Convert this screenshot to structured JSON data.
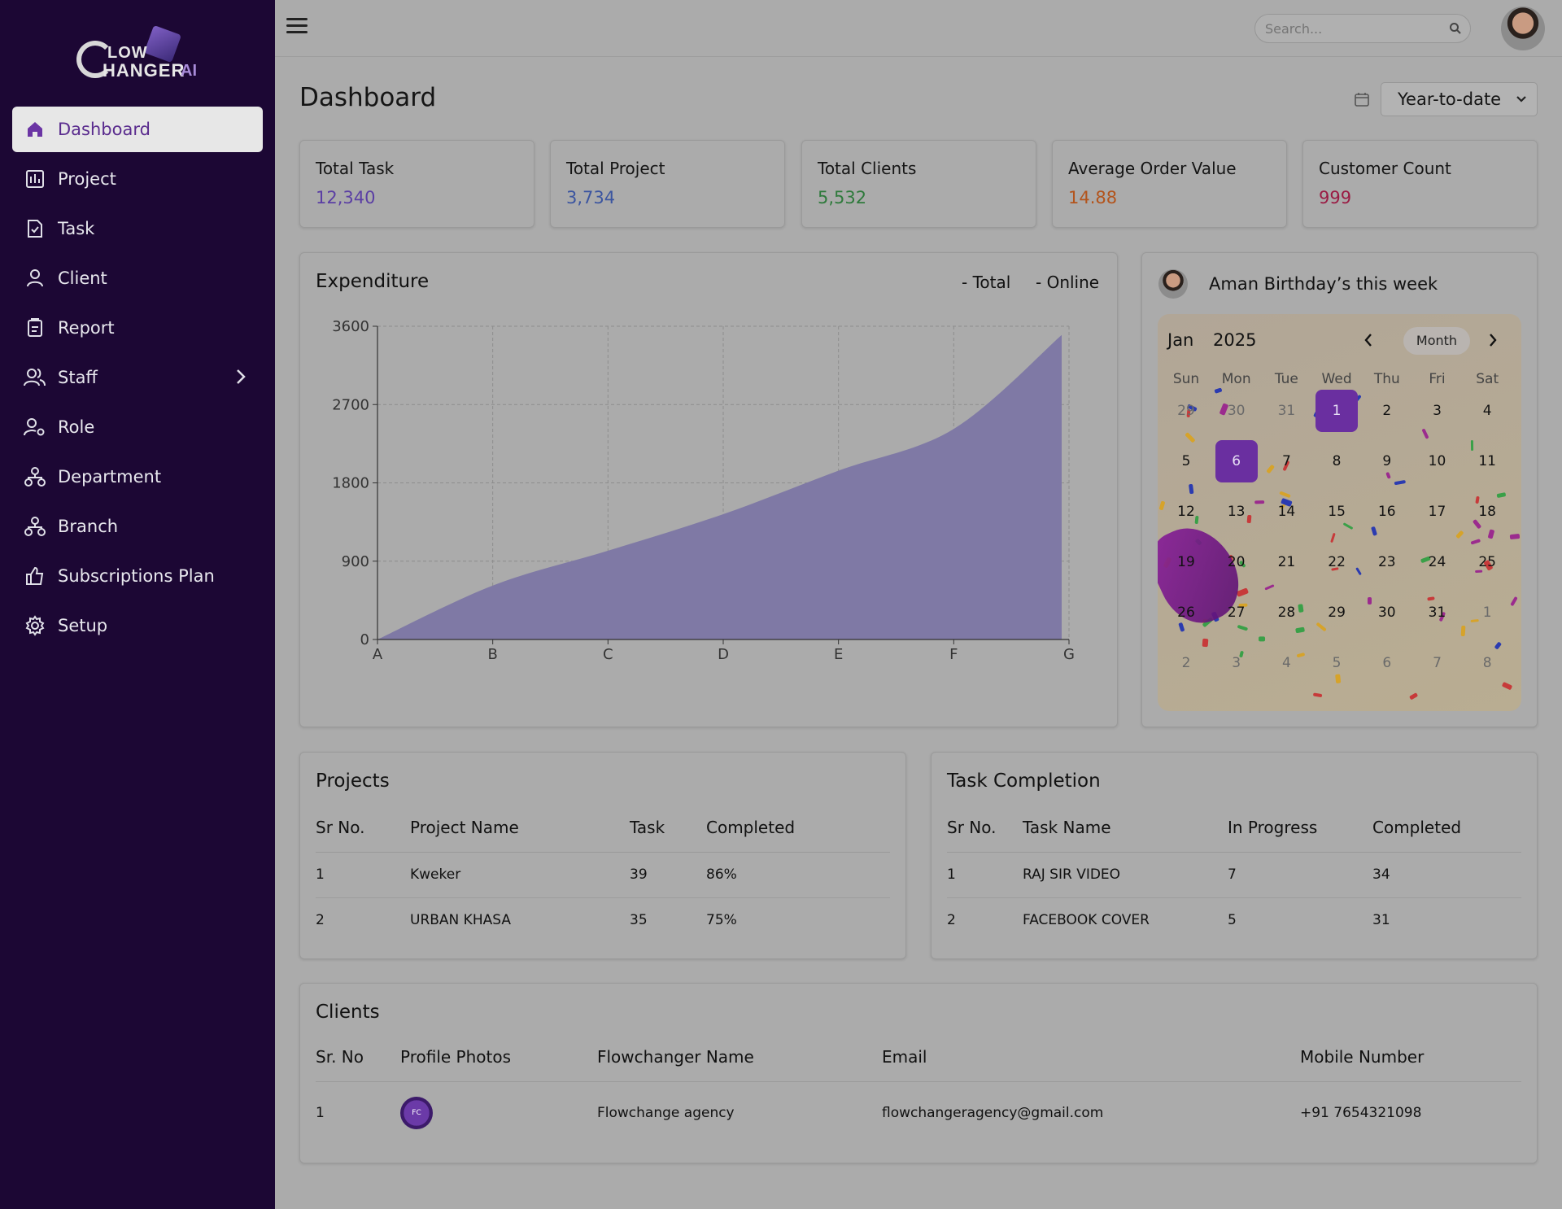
{
  "app": {
    "logo_line1": "LOW",
    "logo_line2": "HANGER",
    "logo_ai": "AI"
  },
  "sidebar": {
    "items": [
      {
        "label": "Dashboard",
        "icon": "home-icon",
        "active": true
      },
      {
        "label": "Project",
        "icon": "chart-board-icon"
      },
      {
        "label": "Task",
        "icon": "task-doc-icon"
      },
      {
        "label": "Client",
        "icon": "user-icon"
      },
      {
        "label": "Report",
        "icon": "clipboard-icon"
      },
      {
        "label": "Staff",
        "icon": "users-icon",
        "has_submenu": true
      },
      {
        "label": "Role",
        "icon": "user-gear-icon"
      },
      {
        "label": "Department",
        "icon": "org-icon"
      },
      {
        "label": "Branch",
        "icon": "branch-icon"
      },
      {
        "label": "Subscriptions Plan",
        "icon": "thumbs-up-icon"
      },
      {
        "label": "Setup",
        "icon": "gear-icon"
      }
    ]
  },
  "header": {
    "search_placeholder": "Search..."
  },
  "page": {
    "title": "Dashboard",
    "period": "Year-to-date"
  },
  "stats": [
    {
      "label": "Total Task",
      "value": "12,340",
      "color": "#5b3fa4"
    },
    {
      "label": "Total Project",
      "value": "3,734",
      "color": "#3b55a0"
    },
    {
      "label": "Total Clients",
      "value": "5,532",
      "color": "#2f7a3c"
    },
    {
      "label": "Average Order Value",
      "value": "14.88",
      "color": "#b3541c"
    },
    {
      "label": "Customer Count",
      "value": "999",
      "color": "#9a1c44"
    }
  ],
  "expenditure": {
    "title": "Expenditure",
    "legend_total": "- Total",
    "legend_online": "- Online"
  },
  "chart_data": {
    "type": "area",
    "categories": [
      "A",
      "B",
      "C",
      "D",
      "E",
      "F",
      "G"
    ],
    "series": [
      {
        "values": [
          0,
          620,
          1020,
          1440,
          1940,
          2420,
          3500
        ]
      }
    ],
    "ylim": [
      0,
      3600
    ],
    "yticks": [
      "0",
      "900",
      "1800",
      "2700",
      "3600"
    ],
    "grid": true,
    "fill_color": "#7f79a5"
  },
  "birthday": {
    "title": "Aman Birthday’s this week",
    "month": "Jan",
    "year": "2025",
    "view_button": "Month",
    "weekdays": [
      "Sun",
      "Mon",
      "Tue",
      "Wed",
      "Thu",
      "Fri",
      "Sat"
    ],
    "weeks": [
      [
        "29",
        "30",
        "31",
        "1",
        "2",
        "3",
        "4"
      ],
      [
        "5",
        "6",
        "7",
        "8",
        "9",
        "10",
        "11"
      ],
      [
        "12",
        "13",
        "14",
        "15",
        "16",
        "17",
        "18"
      ],
      [
        "19",
        "20",
        "21",
        "22",
        "23",
        "24",
        "25"
      ],
      [
        "26",
        "27",
        "28",
        "29",
        "30",
        "31",
        "1"
      ],
      [
        "2",
        "3",
        "4",
        "5",
        "6",
        "7",
        "8"
      ]
    ],
    "selected_days": [
      "1",
      "6"
    ]
  },
  "projects": {
    "title": "Projects",
    "columns": [
      "Sr No.",
      "Project Name",
      "Task",
      "Completed"
    ],
    "rows": [
      [
        "1",
        "Kweker",
        "39",
        "86%"
      ],
      [
        "2",
        "URBAN KHASA",
        "35",
        "75%"
      ]
    ]
  },
  "task_completion": {
    "title": "Task Completion",
    "columns": [
      "Sr No.",
      "Task Name",
      "In Progress",
      "Completed"
    ],
    "rows": [
      [
        "1",
        "RAJ SIR VIDEO",
        "7",
        "34"
      ],
      [
        "2",
        "FACEBOOK COVER",
        "5",
        "31"
      ]
    ]
  },
  "clients": {
    "title": "Clients",
    "columns": [
      "Sr. No",
      "Profile Photos",
      "Flowchanger Name",
      "Email",
      "Mobile Number"
    ],
    "rows": [
      [
        "1",
        "",
        "Flowchange agency",
        "flowchangeragency@gmail.com",
        "+91 7654321098"
      ]
    ]
  }
}
